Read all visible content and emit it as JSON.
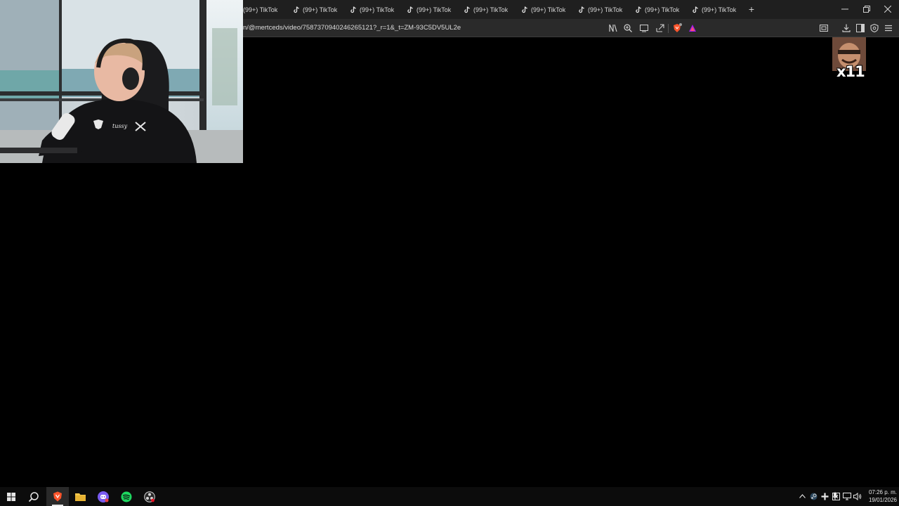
{
  "browser": {
    "tabs": [
      {
        "title": "(99+) TikTok"
      },
      {
        "title": "(99+) TikTok"
      },
      {
        "title": "(99+) TikTok"
      },
      {
        "title": "(99+) TikTok"
      },
      {
        "title": "(99+) TikTok"
      },
      {
        "title": "(99+) TikTok"
      },
      {
        "title": "(99+) TikTok"
      },
      {
        "title": "(99+) TikTok"
      },
      {
        "title": "(99+) TikTok"
      }
    ],
    "new_tab_icon": "plus-icon",
    "window_controls": [
      "minimize-icon",
      "restore-icon",
      "close-icon"
    ],
    "address": {
      "url": "n/@mertceds/video/7587370940246265121?_r=1&_t=ZM-93C5DV5UL2e"
    },
    "toolbar_icons": [
      "reader-mode-icon",
      "zoom-icon",
      "cast-icon",
      "share-icon",
      "brave-shields-icon",
      "brave-rewards-icon",
      "screenshot-icon",
      "download-icon",
      "sidebar-icon",
      "vpn-shield-icon",
      "menu-icon"
    ],
    "accent": "#fb542b"
  },
  "overlay": {
    "emote_count": "x11"
  },
  "taskbar": {
    "apps": [
      "windows-start-icon",
      "search-icon",
      "brave-browser-icon",
      "file-explorer-icon",
      "discord-icon",
      "spotify-icon",
      "obs-icon"
    ],
    "tray_icons": [
      "chevron-up-icon",
      "steam-icon",
      "app-tray-icon",
      "network-tray-icon",
      "microphone-icon",
      "network-icon",
      "volume-icon"
    ],
    "time": "07:26 p. m.",
    "date": "19/01/2026"
  }
}
